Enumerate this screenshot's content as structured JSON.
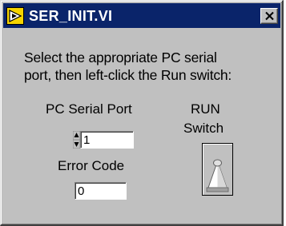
{
  "window": {
    "title": "SER_INIT.VI",
    "icon": "labview-vi-icon",
    "close_icon": "close-icon"
  },
  "instructions": {
    "line1": "Select the appropriate PC serial",
    "line2": "port, then left-click the Run switch:"
  },
  "serial_port": {
    "label": "PC Serial Port",
    "value": "1",
    "stepper_icon": "up-down-arrows-icon"
  },
  "error_code": {
    "label": "Error Code",
    "value": "0"
  },
  "run_switch": {
    "label_line1": "RUN",
    "label_line2": "Switch",
    "state": "off"
  },
  "colors": {
    "titlebar": "#0a246a",
    "panel": "#c0c0c0",
    "icon_background": "#f5d400"
  }
}
